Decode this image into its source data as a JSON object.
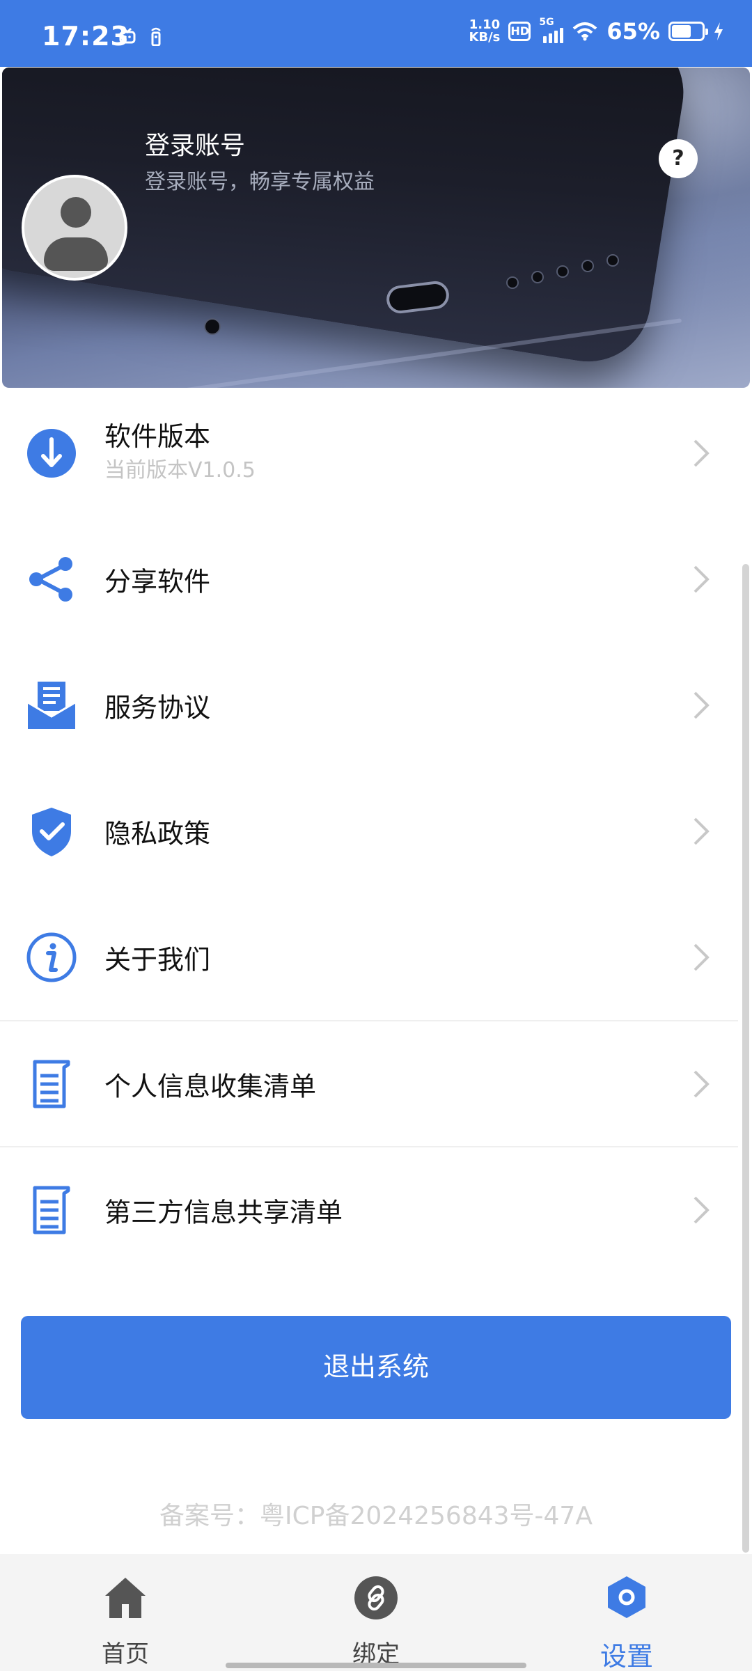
{
  "status_bar": {
    "time": "17:23",
    "net_speed_value": "1.10",
    "net_speed_unit": "KB/s",
    "hd": "HD",
    "signal": "5G",
    "battery_percent": "65%",
    "battery_level": 0.65
  },
  "header": {
    "title": "登录账号",
    "subtitle": "登录账号，畅享专属权益",
    "help_label": "?"
  },
  "menu": {
    "items": [
      {
        "label": "软件版本",
        "sub": "当前版本V1.0.5",
        "icon": "download-icon"
      },
      {
        "label": "分享软件",
        "icon": "share-icon"
      },
      {
        "label": "服务协议",
        "icon": "agreement-icon"
      },
      {
        "label": "隐私政策",
        "icon": "shield-check-icon"
      },
      {
        "label": "关于我们",
        "icon": "info-icon"
      },
      {
        "label": "个人信息收集清单",
        "icon": "list-document-icon"
      },
      {
        "label": "第三方信息共享清单",
        "icon": "list-document-icon"
      }
    ]
  },
  "logout_label": "退出系统",
  "icp_text": "备案号：粤ICP备2024256843号-47A",
  "tabs": [
    {
      "label": "首页",
      "icon": "home-icon"
    },
    {
      "label": "绑定",
      "icon": "link-icon"
    },
    {
      "label": "设置",
      "icon": "settings-icon",
      "active": true
    }
  ],
  "colors": {
    "primary": "#3e7be4",
    "tab_bar_bg": "#f4f4f4"
  }
}
